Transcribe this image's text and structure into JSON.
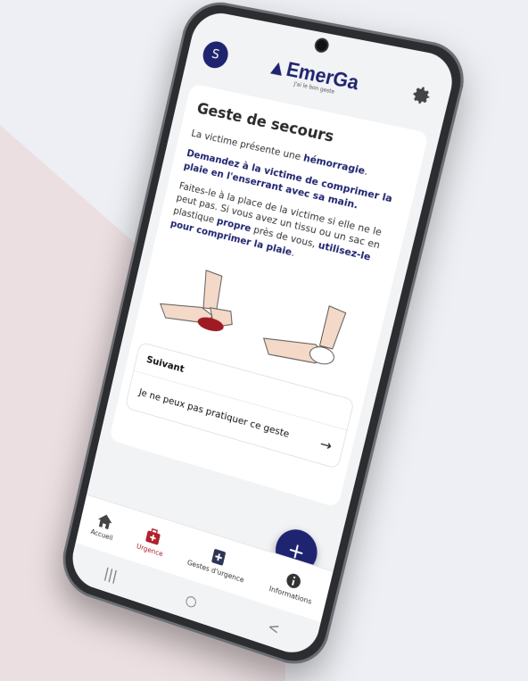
{
  "app": {
    "avatar_letter": "S",
    "logo_name": "EmerGa",
    "logo_tagline": "J'ai le bon geste"
  },
  "card": {
    "title": "Geste de secours",
    "p1_prefix": "La victime présente une ",
    "p1_bold": "hémorragie",
    "p1_suffix": ".",
    "p2_bold": "Demandez à la victime de comprimer la plaie en l'enserrant avec sa main.",
    "p3_prefix": "Faites-le à la place de la victime si elle ne le peut pas. Si vous avez un tissu ou un sac en plastique ",
    "p3_bold1": "propre",
    "p3_mid": " près de vous, ",
    "p3_bold2": "utilisez-le pour comprimer la plaie",
    "p3_suffix": "."
  },
  "next": {
    "title": "Suivant",
    "option_label": "Je ne peux pas pratiquer ce geste",
    "arrow": "→"
  },
  "fab": {
    "label": "+"
  },
  "bottomnav": {
    "items": [
      {
        "label": "Accueil"
      },
      {
        "label": "Urgence"
      },
      {
        "label": "Gestes d'urgence"
      },
      {
        "label": "Informations"
      }
    ]
  },
  "sysnav": {
    "recent": "|||",
    "home": "○",
    "back": "<"
  },
  "colors": {
    "brand": "#1f2470",
    "accent": "#b3202d"
  }
}
